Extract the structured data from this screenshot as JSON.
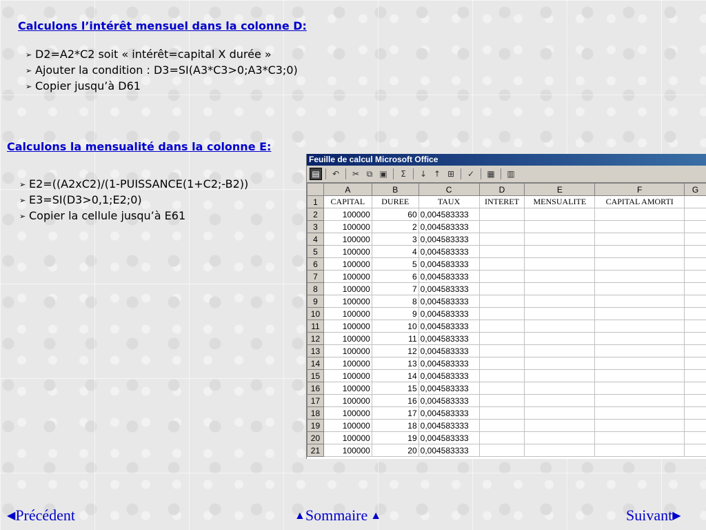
{
  "section1": {
    "heading": "Calculons l’intérêt mensuel dans la colonne D:",
    "bullets": [
      "D2=A2*C2 soit « intérêt=capital X durée »",
      "Ajouter la condition : D3=SI(A3*C3>0;A3*C3;0)",
      "Copier jusqu’à D61"
    ]
  },
  "section2": {
    "heading": "Calculons la mensualité dans la colonne E:",
    "bullets": [
      "E2=((A2xC2)/(1-PUISSANCE(1+C2;-B2))",
      "E3=SI(D3>0,1;E2;0)",
      "Copier la cellule jusqu’à E61"
    ]
  },
  "bullet_arrow": "➢",
  "spreadsheet": {
    "title": "Feuille de calcul Microsoft Office",
    "column_headers": [
      "A",
      "B",
      "C",
      "D",
      "E",
      "F",
      "G"
    ],
    "header_row": [
      "CAPITAL",
      "DUREE",
      "TAUX",
      "INTERET",
      "MENSUALITE",
      "CAPITAL AMORTI",
      ""
    ],
    "rows": [
      [
        "2",
        "100000",
        "60",
        "0,004583333"
      ],
      [
        "3",
        "100000",
        "2",
        "0,004583333"
      ],
      [
        "4",
        "100000",
        "3",
        "0,004583333"
      ],
      [
        "5",
        "100000",
        "4",
        "0,004583333"
      ],
      [
        "6",
        "100000",
        "5",
        "0,004583333"
      ],
      [
        "7",
        "100000",
        "6",
        "0,004583333"
      ],
      [
        "8",
        "100000",
        "7",
        "0,004583333"
      ],
      [
        "9",
        "100000",
        "8",
        "0,004583333"
      ],
      [
        "10",
        "100000",
        "9",
        "0,004583333"
      ],
      [
        "11",
        "100000",
        "10",
        "0,004583333"
      ],
      [
        "12",
        "100000",
        "11",
        "0,004583333"
      ],
      [
        "13",
        "100000",
        "12",
        "0,004583333"
      ],
      [
        "14",
        "100000",
        "13",
        "0,004583333"
      ],
      [
        "15",
        "100000",
        "14",
        "0,004583333"
      ],
      [
        "16",
        "100000",
        "15",
        "0,004583333"
      ],
      [
        "17",
        "100000",
        "16",
        "0,004583333"
      ],
      [
        "18",
        "100000",
        "17",
        "0,004583333"
      ],
      [
        "19",
        "100000",
        "18",
        "0,004583333"
      ],
      [
        "20",
        "100000",
        "19",
        "0,004583333"
      ],
      [
        "21",
        "100000",
        "20",
        "0,004583333"
      ]
    ],
    "toolbar_icons": [
      "excel-logo-icon",
      "undo-icon",
      "cut-icon",
      "copy-icon",
      "paste-icon",
      "autosum-icon",
      "sort-ascending-icon",
      "sort-descending-icon",
      "autofilter-icon",
      "spell-check-icon",
      "export-icon",
      "properties-icon"
    ]
  },
  "navigation": {
    "prev_label": "Précédent",
    "home_label": "Sommaire",
    "next_label": "Suivant"
  },
  "colors": {
    "link": "#0000cc",
    "titlebar": "#0a246a"
  }
}
